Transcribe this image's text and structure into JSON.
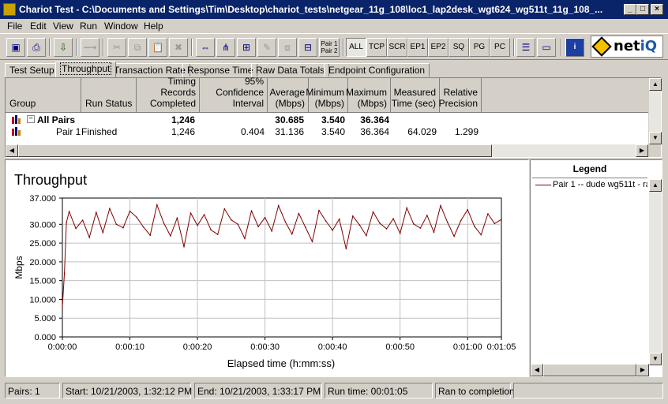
{
  "window": {
    "title": "Chariot Test - C:\\Documents and Settings\\Tim\\Desktop\\chariot_tests\\netgear_11g_108\\loc1_lap2desk_wgt624_wg511t_11g_108_...",
    "minimize": "_",
    "maximize": "□",
    "close": "×"
  },
  "menu": [
    "File",
    "Edit",
    "View",
    "Run",
    "Window",
    "Help"
  ],
  "toolbar": {
    "pair_button": [
      "Pair 1",
      "Pair 2"
    ],
    "protocol_buttons": [
      "ALL",
      "TCP",
      "SCR",
      "EP1",
      "EP2",
      "SQ",
      "PG",
      "PC"
    ],
    "logo_net": "net",
    "logo_iq": "iQ"
  },
  "tabs": [
    "Test Setup",
    "Throughput",
    "Transaction Rate",
    "Response Time",
    "Raw Data Totals",
    "Endpoint Configuration"
  ],
  "grid": {
    "headers": {
      "group": "Group",
      "run_status": "Run Status",
      "timing_1": "Timing Records",
      "timing_2": "Completed",
      "conf_1": "95% Confidence",
      "conf_2": "Interval",
      "avg_1": "Average",
      "avg_2": "(Mbps)",
      "min_1": "Minimum",
      "min_2": "(Mbps)",
      "max_1": "Maximum",
      "max_2": "(Mbps)",
      "meas_1": "Measured",
      "meas_2": "Time (sec)",
      "rel_1": "Relative",
      "rel_2": "Precision"
    },
    "rows": [
      {
        "expander": "−",
        "group": "All Pairs",
        "run_status": "",
        "timing": "1,246",
        "confidence": "",
        "average": "30.685",
        "minimum": "3.540",
        "maximum": "36.364",
        "measured": "",
        "relative": ""
      },
      {
        "expander": "",
        "group": "Pair 1",
        "run_status": "Finished",
        "timing": "1,246",
        "confidence": "0.404",
        "average": "31.136",
        "minimum": "3.540",
        "maximum": "36.364",
        "measured": "64.029",
        "relative": "1.299"
      }
    ]
  },
  "chart_data": {
    "type": "line",
    "title": "Throughput",
    "xlabel": "Elapsed time (h:mm:ss)",
    "ylabel": "Mbps",
    "x_ticks": [
      "0:00:00",
      "0:00:10",
      "0:00:20",
      "0:00:30",
      "0:00:40",
      "0:00:50",
      "0:01:00",
      "0:01:05"
    ],
    "y_ticks": [
      "0.000",
      "5.000",
      "10.000",
      "15.000",
      "20.000",
      "25.000",
      "30.000",
      "37.000"
    ],
    "xlim": [
      0,
      65
    ],
    "ylim": [
      0,
      37
    ],
    "grid": true,
    "series": [
      {
        "name": "Pair 1 -- dude wg511t - ra",
        "color": "#800000",
        "x": [
          0.0,
          0.3,
          0.6,
          1,
          2,
          3,
          4,
          5,
          6,
          7,
          8,
          9,
          10,
          11,
          12,
          13,
          14,
          15,
          16,
          17,
          18,
          19,
          20,
          21,
          22,
          23,
          24,
          25,
          26,
          27,
          28,
          29,
          30,
          31,
          32,
          33,
          34,
          35,
          36,
          37,
          38,
          39,
          40,
          41,
          42,
          43,
          44,
          45,
          46,
          47,
          48,
          49,
          50,
          51,
          52,
          53,
          54,
          55,
          56,
          57,
          58,
          59,
          60,
          61,
          62,
          63,
          64,
          65
        ],
        "y": [
          8.0,
          17.0,
          30.5,
          33.4,
          28.9,
          31.1,
          26.5,
          33.2,
          27.8,
          34.2,
          30.0,
          29.1,
          33.5,
          31.9,
          29.3,
          27.1,
          35.2,
          30.4,
          26.9,
          31.7,
          24.0,
          33.0,
          29.7,
          32.6,
          28.5,
          27.3,
          34.1,
          31.2,
          30.0,
          26.2,
          33.6,
          29.4,
          31.8,
          28.2,
          35.0,
          30.7,
          27.4,
          32.9,
          29.2,
          25.4,
          33.7,
          30.9,
          28.4,
          31.4,
          23.5,
          32.2,
          29.8,
          27.0,
          33.3,
          30.3,
          28.8,
          31.5,
          27.6,
          34.4,
          30.1,
          29.0,
          32.4,
          27.9,
          35.0,
          30.6,
          26.8,
          31.0,
          33.9,
          29.5,
          27.2,
          32.8,
          30.2,
          31.3
        ]
      }
    ]
  },
  "legend": {
    "title": "Legend",
    "entries": [
      "Pair 1 -- dude wg511t - ra"
    ]
  },
  "status": {
    "pairs": "Pairs: 1",
    "start": "Start: 10/21/2003, 1:32:12 PM",
    "end": "End: 10/21/2003, 1:33:17 PM",
    "runtime": "Run time: 00:01:05",
    "state": "Ran to completion"
  }
}
